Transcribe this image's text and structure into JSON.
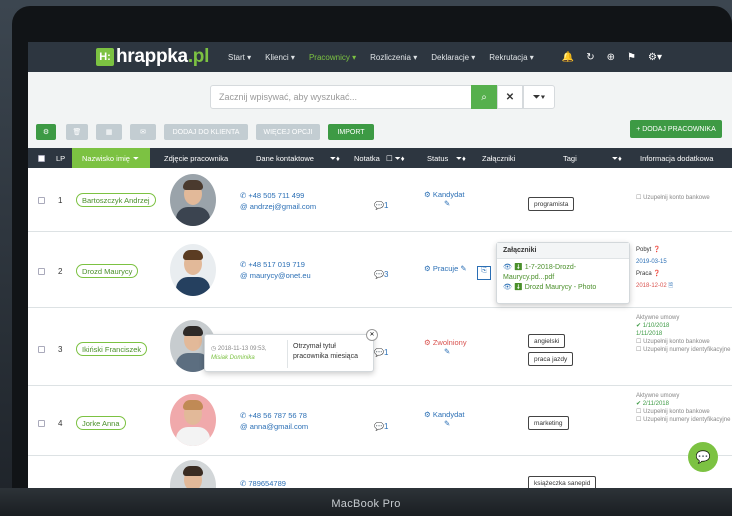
{
  "app": {
    "logo_badge": "H:",
    "logo_text": "hrappka",
    "logo_tld": ".pl",
    "device_label": "MacBook Pro"
  },
  "nav": {
    "items": [
      "Start ▾",
      "Klienci ▾",
      "Pracownicy ▾",
      "Rozliczenia ▾",
      "Deklaracje ▾",
      "Rekrutacja ▾"
    ],
    "active_index": 2
  },
  "search": {
    "placeholder": "Zacznij wpisywać, aby wyszukać..."
  },
  "toolbar": {
    "add_to_client": "DODAJ DO KLIENTA",
    "more_options": "WIĘCEJ OPCJI",
    "import": "IMPORT",
    "add_employee": "+ DODAJ PRACOWNIKA"
  },
  "table": {
    "headers": {
      "lp": "LP",
      "name": "Nazwisko imię",
      "photo": "Zdjęcie pracownika",
      "contact": "Dane kontaktowe",
      "note": "Notatka",
      "status": "Status",
      "attachments": "Załączniki",
      "tags": "Tagi",
      "extra": "Informacja dodatkowa"
    },
    "rows": [
      {
        "lp": "1",
        "name": "Bartoszczyk Andrzej",
        "phone": "✆ +48 505 711 499",
        "email": "@ andrzej@gmail.com",
        "notes": "1",
        "status": "Kandydat",
        "tag1": "programista",
        "tag2": "",
        "info1": "Uzupełnij konto bankowe"
      },
      {
        "lp": "2",
        "name": "Drozd Maurycy",
        "phone": "✆ +48 517 019 719",
        "email": "@ maurycy@onet.eu",
        "notes": "3",
        "status": "Pracuje",
        "tag1": "",
        "tag2": "",
        "info1": ""
      },
      {
        "lp": "3",
        "name": "Ikiński Franciszek",
        "phone": "",
        "email": "",
        "notes": "1",
        "status": "Zwolniony",
        "tag1": "angielski",
        "tag2": "praca jazdy",
        "info1": ""
      },
      {
        "lp": "4",
        "name": "Jorke Anna",
        "phone": "✆ +48 56 787 56 78",
        "email": "@ anna@gmail.com",
        "notes": "1",
        "status": "Kandydat",
        "tag1": "marketing",
        "tag2": "",
        "info1": ""
      },
      {
        "lp": "5",
        "name": "",
        "phone": "✆ 789654789",
        "email": "",
        "notes": "",
        "status": "",
        "tag1": "książeczka sanepid",
        "tag2": "",
        "info1": ""
      }
    ],
    "row2_extra": {
      "pobyt": "Pobyt",
      "pobyt_date": "2019-03-15",
      "praca": "Praca",
      "praca_date": "2018-12-02"
    },
    "row3_extra": {
      "active": "Aktywne umowy",
      "d1": "1/10/2018",
      "d2": "1/11/2018",
      "bank": "Uzupełnij konto bankowe",
      "id": "Uzupełnij numery identyfikacyjne"
    },
    "row4_extra": {
      "active": "Aktywne umowy",
      "d1": "2/11/2018",
      "bank": "Uzupełnij konto bankowe",
      "id": "Uzupełnij numery identyfikacyjne"
    }
  },
  "attachments_popup": {
    "title": "Załączniki",
    "file1": "1-7-2018-Drozd-Maurycy.pd...pdf",
    "file2": "Drozd Maurycy - Photo"
  },
  "note_popup": {
    "date": "2018-11-13 09:53,",
    "author": "Misiak Dominika",
    "text": "Otrzymał tytuł pracownika miesiąca"
  },
  "colors": {
    "brand_green": "#7cc242",
    "nav_dark": "#2d3640",
    "link_blue": "#2b6fb5",
    "status_red": "#d9534f"
  }
}
